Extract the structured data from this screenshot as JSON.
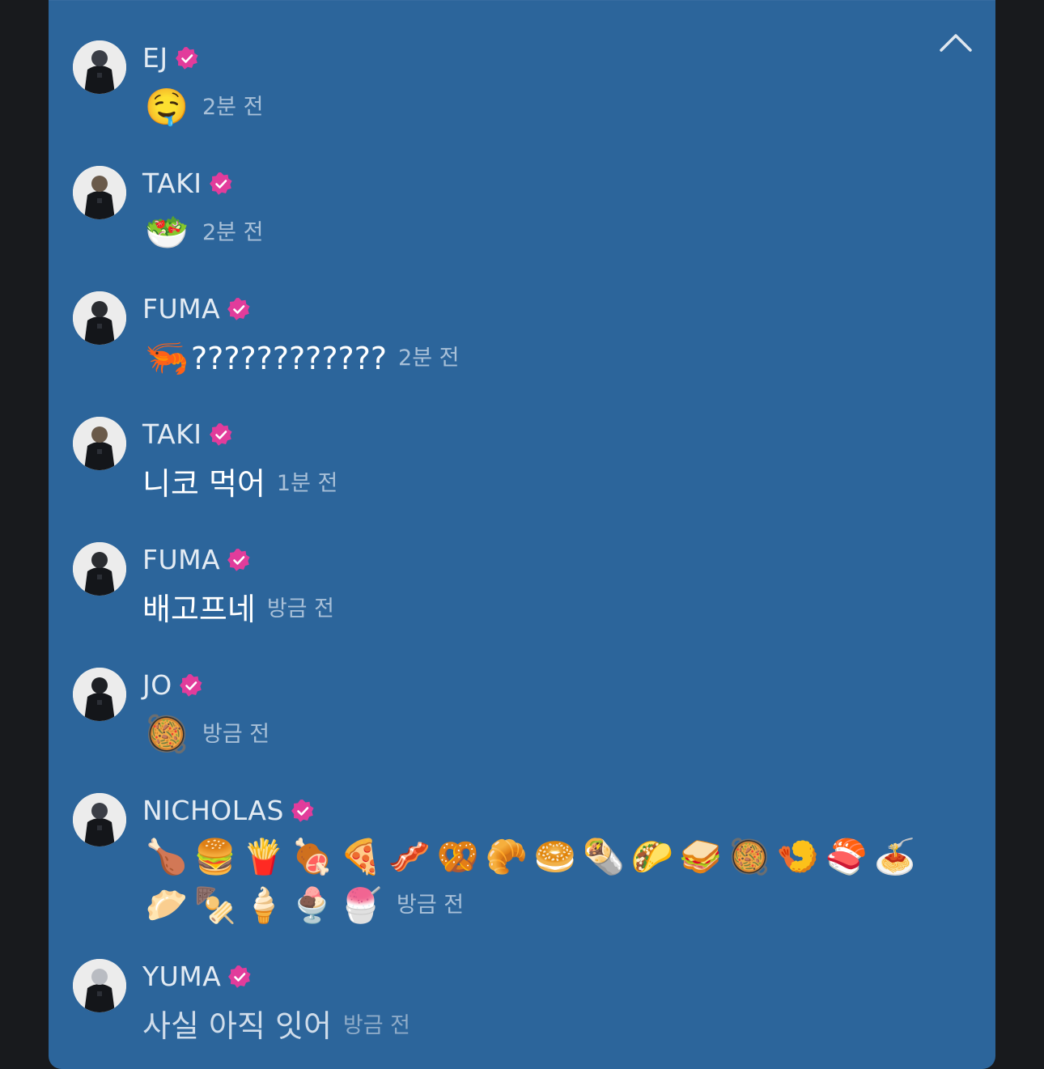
{
  "colors": {
    "panel_bg": "#2c659b",
    "page_bg": "#181a1d",
    "verified_badge": "#e23c9b",
    "name_text": "#e3ebf3",
    "time_text": "#a8c0d8"
  },
  "header": {
    "collapse_icon": "chevron-up-icon"
  },
  "messages": [
    {
      "name": "EJ",
      "emoji": "🤤",
      "text": "",
      "time": "2분 전"
    },
    {
      "name": "TAKI",
      "emoji": "🥗",
      "text": "",
      "time": "2분 전"
    },
    {
      "name": "FUMA",
      "emoji": "🦐",
      "text": "????????????",
      "time": "2분 전"
    },
    {
      "name": "TAKI",
      "emoji": "",
      "text": "니코 먹어",
      "time": "1분 전"
    },
    {
      "name": "FUMA",
      "emoji": "",
      "text": "배고프네",
      "time": "방금 전"
    },
    {
      "name": "JO",
      "emoji": "🥘",
      "text": "",
      "time": "방금 전"
    },
    {
      "name": "NICHOLAS",
      "emoji_line_1": [
        "🍗",
        "🍔",
        "🍟",
        "🍖",
        "🍕",
        "🥓",
        "🥨",
        "🥐",
        "🥯",
        "🌯",
        "🌮",
        "🥪",
        "🥘",
        "🍤",
        "🍣",
        "🍝"
      ],
      "emoji_line_2": [
        "🥟",
        "🍢",
        "🍦",
        "🍨",
        "🍧"
      ],
      "time": "방금 전"
    },
    {
      "name": "YUMA",
      "emoji": "",
      "text": "사실 아직 잇어",
      "time": "방금 전"
    }
  ]
}
